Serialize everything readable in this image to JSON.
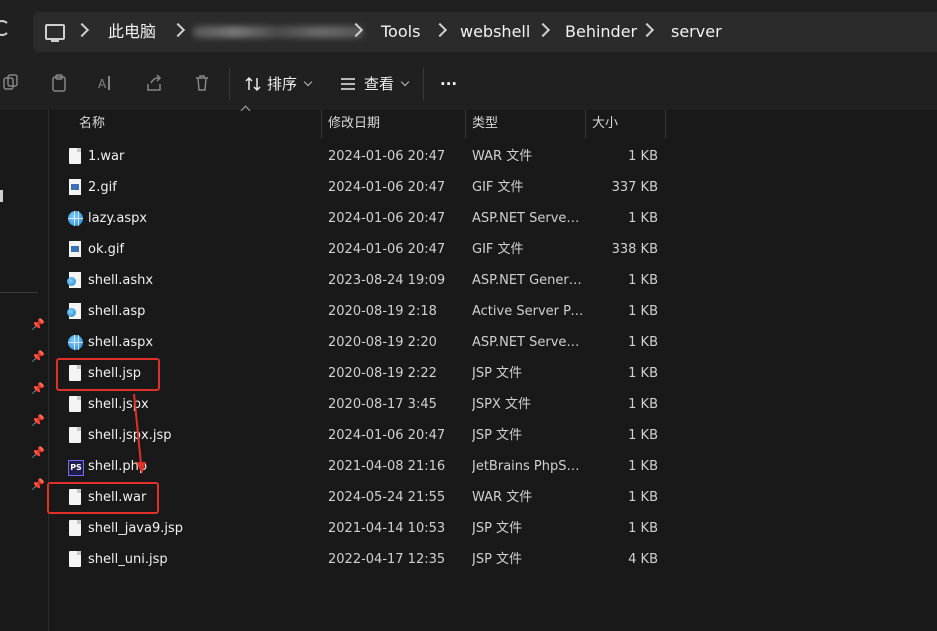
{
  "address": {
    "crumbs": [
      "此电脑",
      "Tools",
      "webshell",
      "Behinder",
      "server"
    ]
  },
  "toolbar": {
    "sort_label": "排序",
    "view_label": "查看",
    "more_label": "···"
  },
  "columns": {
    "name": "名称",
    "date": "修改日期",
    "type": "类型",
    "size": "大小"
  },
  "files": [
    {
      "name": "1.war",
      "date": "2024-01-06 20:47",
      "type": "WAR 文件",
      "size": "1 KB",
      "icon": "file-icon"
    },
    {
      "name": "2.gif",
      "date": "2024-01-06 20:47",
      "type": "GIF 文件",
      "size": "337 KB",
      "icon": "gif-icon"
    },
    {
      "name": "lazy.aspx",
      "date": "2024-01-06 20:47",
      "type": "ASP.NET Server ...",
      "size": "1 KB",
      "icon": "aspx-globe-icon"
    },
    {
      "name": "ok.gif",
      "date": "2024-01-06 20:47",
      "type": "GIF 文件",
      "size": "338 KB",
      "icon": "gif-icon"
    },
    {
      "name": "shell.ashx",
      "date": "2023-08-24 19:09",
      "type": "ASP.NET Generic...",
      "size": "1 KB",
      "icon": "asp-icon"
    },
    {
      "name": "shell.asp",
      "date": "2020-08-19 2:18",
      "type": "Active Server Pa...",
      "size": "1 KB",
      "icon": "asp-icon"
    },
    {
      "name": "shell.aspx",
      "date": "2020-08-19 2:20",
      "type": "ASP.NET Server ...",
      "size": "1 KB",
      "icon": "aspx-globe-icon"
    },
    {
      "name": "shell.jsp",
      "date": "2020-08-19 2:22",
      "type": "JSP 文件",
      "size": "1 KB",
      "icon": "file-icon"
    },
    {
      "name": "shell.jspx",
      "date": "2020-08-17 3:45",
      "type": "JSPX 文件",
      "size": "1 KB",
      "icon": "file-icon"
    },
    {
      "name": "shell.jspx.jsp",
      "date": "2024-01-06 20:47",
      "type": "JSP 文件",
      "size": "1 KB",
      "icon": "file-icon"
    },
    {
      "name": "shell.php",
      "date": "2021-04-08 21:16",
      "type": "JetBrains PhpSto...",
      "size": "1 KB",
      "icon": "phpstorm-icon"
    },
    {
      "name": "shell.war",
      "date": "2024-05-24 21:55",
      "type": "WAR 文件",
      "size": "1 KB",
      "icon": "file-icon"
    },
    {
      "name": "shell_java9.jsp",
      "date": "2021-04-14 10:53",
      "type": "JSP 文件",
      "size": "1 KB",
      "icon": "file-icon"
    },
    {
      "name": "shell_uni.jsp",
      "date": "2022-04-17 12:35",
      "type": "JSP 文件",
      "size": "4 KB",
      "icon": "file-icon"
    }
  ],
  "colors": {
    "highlight": "#e0302a",
    "background": "#191919"
  }
}
